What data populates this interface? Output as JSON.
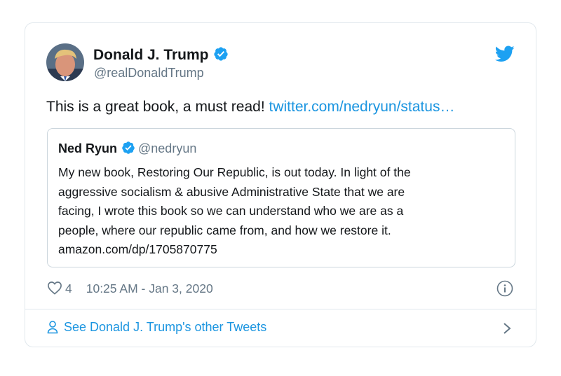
{
  "tweet": {
    "author": {
      "name": "Donald J. Trump",
      "handle": "@realDonaldTrump",
      "verified": true,
      "avatar_icon": "avatar-photo"
    },
    "text": "This is a great book, a must read!",
    "link_text": "twitter.com/nedryun/status…",
    "quoted_tweet": {
      "name": "Ned Ryun",
      "handle": "@nedryun",
      "verified": true,
      "body_lines": [
        "My new book, Restoring Our Republic, is out today. In light of the",
        "aggressive socialism & abusive Administrative State that we are",
        "facing, I wrote this book so we can understand who we are as a",
        "people, where our republic came from, and how we restore it.",
        "amazon.com/dp/1705870775"
      ]
    },
    "likes": "4",
    "timestamp": "10:25 AM - Jan 3, 2020",
    "footer_link": "See Donald J. Trump's other Tweets"
  },
  "icons": {
    "brand": "twitter-bird-icon",
    "verified": "verified-badge-icon",
    "like": "heart-icon",
    "info": "info-icon",
    "footer": "person-icon",
    "chevron": "chevron-right-icon"
  },
  "colors": {
    "link": "#1b95e0",
    "secondary_text": "#657786",
    "primary_text": "#14171a",
    "border": "#e1e8ed"
  }
}
